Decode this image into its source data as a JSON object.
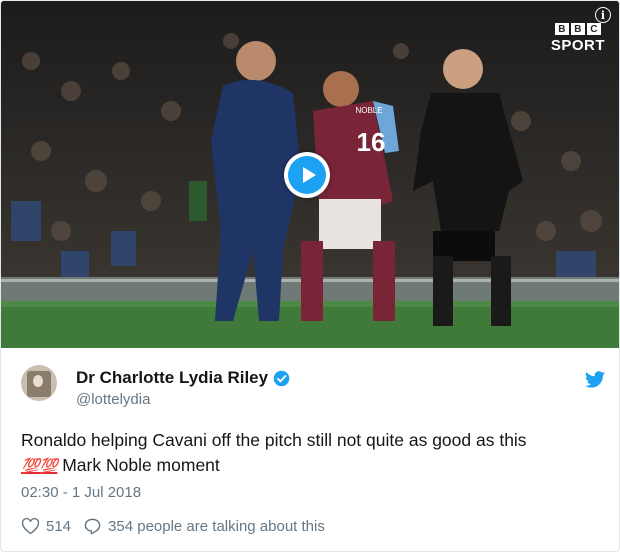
{
  "media": {
    "info_icon_glyph": "i",
    "brand_blocks": [
      "B",
      "B",
      "C"
    ],
    "brand_label": "SPORT",
    "shirt_number": "16",
    "shirt_name": "NOBLE"
  },
  "tweet": {
    "display_name": "Dr Charlotte Lydia Riley",
    "handle": "@lottelydia",
    "text_line1": "Ronaldo helping Cavani off the pitch still not quite as good as this",
    "emoji": "💯💯",
    "text_line2": " Mark Noble moment",
    "timestamp": "02:30 - 1 Jul 2018",
    "likes": "514",
    "replies_text": "354 people are talking about this"
  },
  "colors": {
    "twitter_blue": "#1da1f2",
    "muted_gray": "#657786",
    "text_dark": "#14171a",
    "pitch_green": "#3f7a3a",
    "claret": "#7a2438"
  }
}
